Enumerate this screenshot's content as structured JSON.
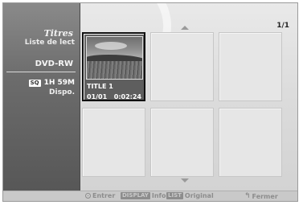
{
  "sidebar": {
    "title": "Titres",
    "subtitle": "Liste de lect",
    "disc": "DVD-RW",
    "quality_badge": "SQ",
    "time_remaining": "1H 59M",
    "status": "Dispo."
  },
  "page": {
    "indicator": "1/1"
  },
  "titles": [
    {
      "name": "TITLE 1",
      "index": "01/01",
      "duration": "0:02:24",
      "selected": true
    }
  ],
  "footer": {
    "enter_label": "Entrer",
    "display_key": "DISPLAY",
    "info_label": "Info",
    "list_key": "LIST",
    "original_label": "Original",
    "close_label": "Fermer"
  }
}
